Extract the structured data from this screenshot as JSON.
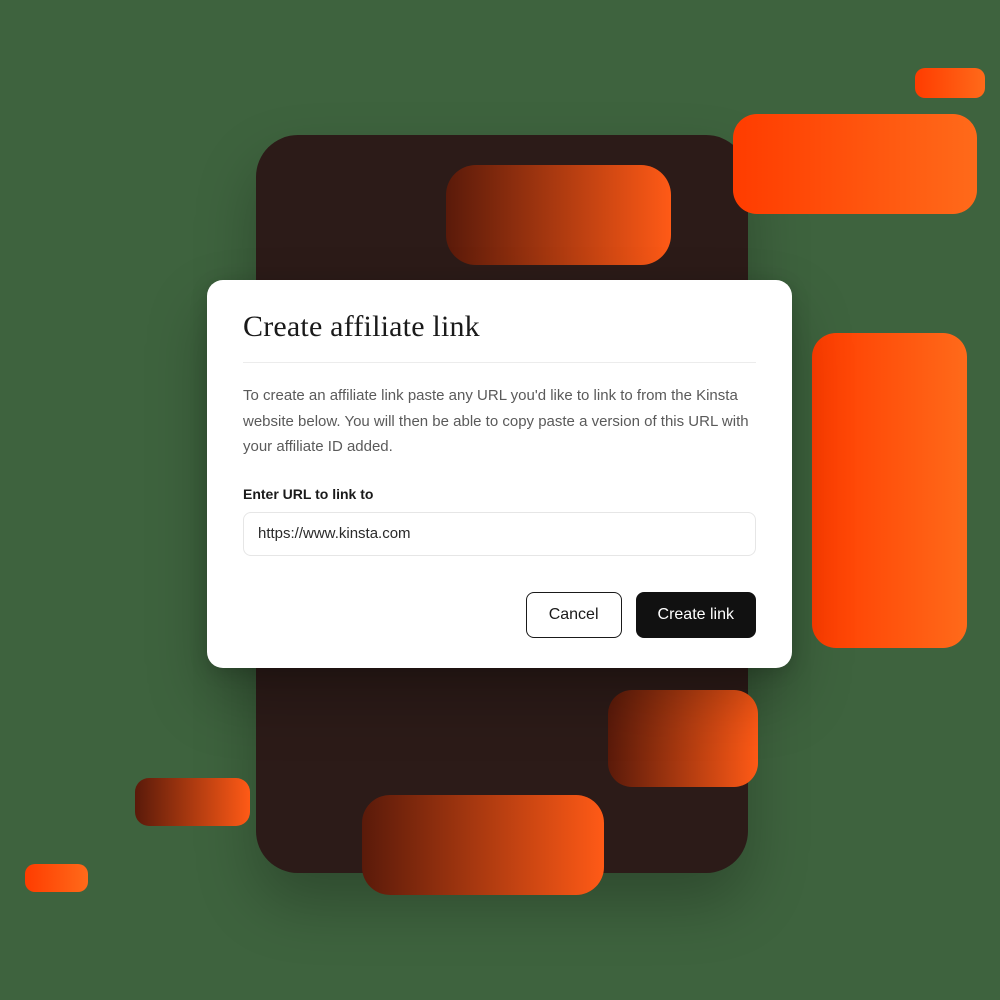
{
  "modal": {
    "title": "Create affiliate link",
    "description": "To create an affiliate link paste any URL you'd like to link to from the Kinsta website below. You will then be able to copy paste a version of this URL with your affiliate ID added.",
    "field_label": "Enter URL to link to",
    "url_value": "https://www.kinsta.com",
    "cancel_label": "Cancel",
    "submit_label": "Create link"
  }
}
